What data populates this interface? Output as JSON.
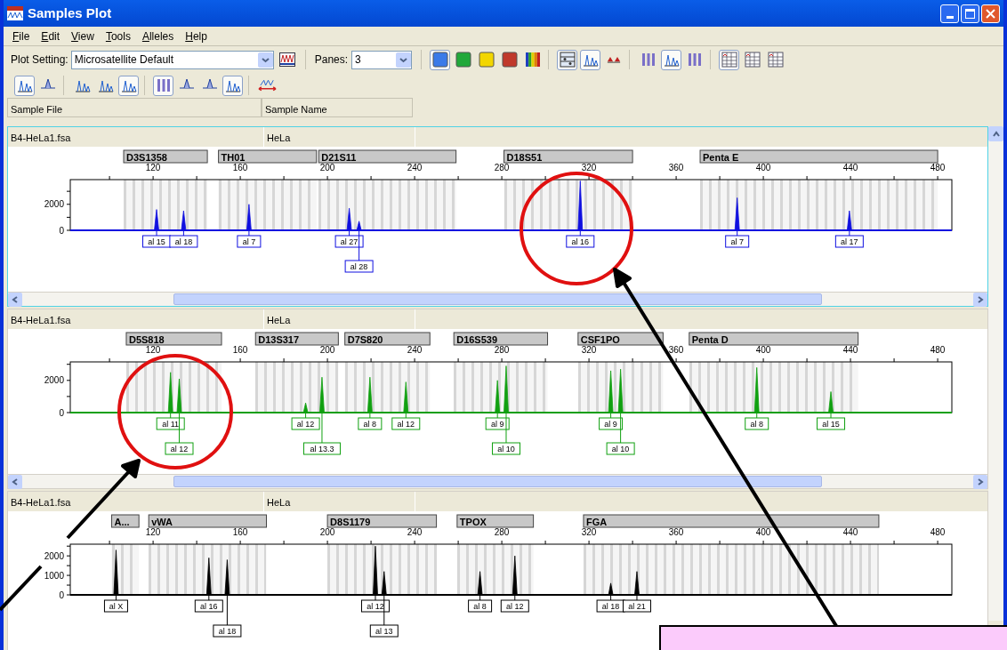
{
  "window": {
    "title": "Samples Plot"
  },
  "menu": [
    "File",
    "Edit",
    "View",
    "Tools",
    "Alleles",
    "Help"
  ],
  "toolbar": {
    "plot_setting_label": "Plot Setting:",
    "plot_setting": "Microsatellite Default",
    "panes_label": "Panes:",
    "panes": "3",
    "groups": [
      [
        {
          "kind": "swatch",
          "color": "#3b7ae8",
          "pressed": true
        },
        {
          "kind": "swatch",
          "color": "#22a83a",
          "pressed": false
        },
        {
          "kind": "swatch",
          "color": "#f2d600",
          "pressed": false
        },
        {
          "kind": "swatch",
          "color": "#c0392b",
          "pressed": false
        },
        {
          "kind": "spectrum",
          "pressed": false
        }
      ],
      [
        {
          "kind": "grid",
          "pressed": true
        },
        {
          "kind": "peaks",
          "pressed": true
        },
        {
          "kind": "triangles",
          "pressed": false
        }
      ],
      [
        {
          "kind": "bars",
          "pressed": false
        },
        {
          "kind": "peaks",
          "pressed": true
        },
        {
          "kind": "bars",
          "pressed": false
        }
      ],
      [
        {
          "kind": "table",
          "pressed": true
        },
        {
          "kind": "table",
          "pressed": false
        },
        {
          "kind": "table",
          "pressed": false
        }
      ]
    ]
  },
  "toolbar2": {
    "groups": [
      [
        {
          "kind": "peaks",
          "pressed": true
        },
        {
          "kind": "peak",
          "pressed": false
        }
      ],
      [
        {
          "kind": "peaks",
          "pressed": false
        },
        {
          "kind": "peaks",
          "pressed": false
        },
        {
          "kind": "peaks",
          "pressed": true
        }
      ],
      [
        {
          "kind": "bars",
          "pressed": true
        },
        {
          "kind": "peak",
          "pressed": false
        },
        {
          "kind": "peak",
          "pressed": false
        },
        {
          "kind": "peaks",
          "pressed": true
        }
      ],
      [
        {
          "kind": "span",
          "pressed": false
        }
      ]
    ]
  },
  "table_header": [
    "Sample File",
    "Sample Name"
  ],
  "panes": [
    {
      "sample_file": "B4-HeLa1.fsa",
      "sample_name": "HeLa",
      "active": true,
      "color": "#1010e0",
      "scrollbar": true,
      "chart_data": {
        "type": "area",
        "xlim": [
          82,
          486.5
        ],
        "ylim": [
          0,
          3900
        ],
        "xticks": [
          120,
          160,
          200,
          240,
          280,
          320,
          360,
          400,
          440,
          480
        ],
        "yticks": [
          0,
          2000
        ],
        "x": [
          121.6,
          134,
          164,
          210,
          214.5,
          316,
          388,
          439.5
        ],
        "values": [
          1600,
          1500,
          2000,
          1700,
          700,
          3800,
          2500,
          1500
        ],
        "bands": [
          {
            "axis": "x",
            "from": 106.5,
            "to": 144.9,
            "label": "D3S1358"
          },
          {
            "axis": "x",
            "from": 150,
            "to": 195,
            "label": "TH01"
          },
          {
            "axis": "x",
            "from": 196,
            "to": 259,
            "label": "D21S11"
          },
          {
            "axis": "x",
            "from": 281,
            "to": 340,
            "label": "D18S51"
          },
          {
            "axis": "x",
            "from": 371,
            "to": 480,
            "label": "Penta E"
          }
        ],
        "annotations": [
          "al 15",
          "al 18",
          "al 7",
          "al 27",
          "al 28",
          "al 16",
          "al 7",
          "al 17"
        ]
      }
    },
    {
      "sample_file": "B4-HeLa1.fsa",
      "sample_name": "HeLa",
      "active": false,
      "color": "#10a010",
      "scrollbar": true,
      "chart_data": {
        "type": "area",
        "xlim": [
          82,
          486.5
        ],
        "ylim": [
          0,
          3150
        ],
        "xticks": [
          120,
          160,
          200,
          240,
          280,
          320,
          360,
          400,
          440,
          480
        ],
        "yticks": [
          0,
          2000
        ],
        "x": [
          128,
          132,
          190,
          197.5,
          219.5,
          236,
          278,
          282,
          330,
          334.5,
          397,
          431
        ],
        "values": [
          2500,
          2100,
          600,
          2200,
          2200,
          1900,
          2000,
          2900,
          2600,
          2700,
          2800,
          1300
        ],
        "bands": [
          {
            "axis": "x",
            "from": 107.7,
            "to": 151.4,
            "label": "D5S818"
          },
          {
            "axis": "x",
            "from": 167,
            "to": 205,
            "label": "D13S317"
          },
          {
            "axis": "x",
            "from": 208,
            "to": 247,
            "label": "D7S820"
          },
          {
            "axis": "x",
            "from": 258,
            "to": 301,
            "label": "D16S539"
          },
          {
            "axis": "x",
            "from": 315,
            "to": 354,
            "label": "CSF1PO"
          },
          {
            "axis": "x",
            "from": 366,
            "to": 443.5,
            "label": "Penta D"
          }
        ],
        "annotations": [
          "al 11",
          "al 12",
          "al 12",
          "al 13.3",
          "al 8",
          "al 12",
          "al 9",
          "al 10",
          "al 9",
          "al 10",
          "al 8",
          "al 15"
        ]
      }
    },
    {
      "sample_file": "B4-HeLa1.fsa",
      "sample_name": "HeLa",
      "active": false,
      "color": "#000000",
      "chart_data": {
        "type": "area",
        "xlim": [
          82,
          486.5
        ],
        "ylim": [
          0,
          2600
        ],
        "xticks": [
          120,
          160,
          200,
          240,
          280,
          320,
          360,
          400,
          440,
          480
        ],
        "yticks": [
          0,
          1000,
          2000
        ],
        "x": [
          103,
          145.6,
          154,
          222,
          226,
          270,
          286,
          330,
          342
        ],
        "values": [
          2300,
          1900,
          1800,
          2500,
          1200,
          1200,
          2000,
          600,
          1200
        ],
        "bands": [
          {
            "axis": "x",
            "from": 101,
            "to": 113.5,
            "label": "A..."
          },
          {
            "axis": "x",
            "from": 118,
            "to": 172,
            "label": "vWA"
          },
          {
            "axis": "x",
            "from": 200,
            "to": 250,
            "label": "D8S1179"
          },
          {
            "axis": "x",
            "from": 259.5,
            "to": 294.5,
            "label": "TPOX"
          },
          {
            "axis": "x",
            "from": 317.5,
            "to": 453,
            "label": "FGA"
          }
        ],
        "annotations": [
          "al X",
          "al 16",
          "al 18",
          "al 12",
          "al 13",
          "al 8",
          "al 12",
          "al 18",
          "al 21"
        ]
      }
    }
  ]
}
